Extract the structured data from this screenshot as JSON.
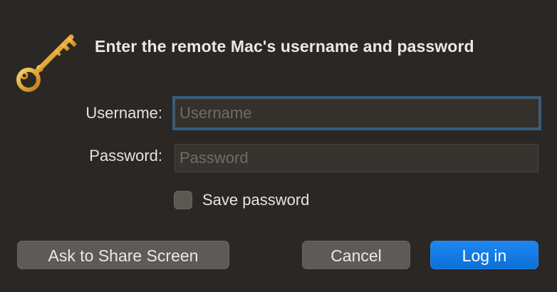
{
  "dialog": {
    "title": "Enter the remote Mac's username and password",
    "icon": "key-icon",
    "accent_color": "#0a84ff"
  },
  "form": {
    "username_label": "Username:",
    "username_value": "",
    "username_placeholder": "Username",
    "password_label": "Password:",
    "password_value": "",
    "password_placeholder": "Password",
    "save_password_label": "Save password",
    "save_password_checked": false
  },
  "buttons": {
    "share_label": "Ask to Share Screen",
    "cancel_label": "Cancel",
    "login_label": "Log in"
  }
}
